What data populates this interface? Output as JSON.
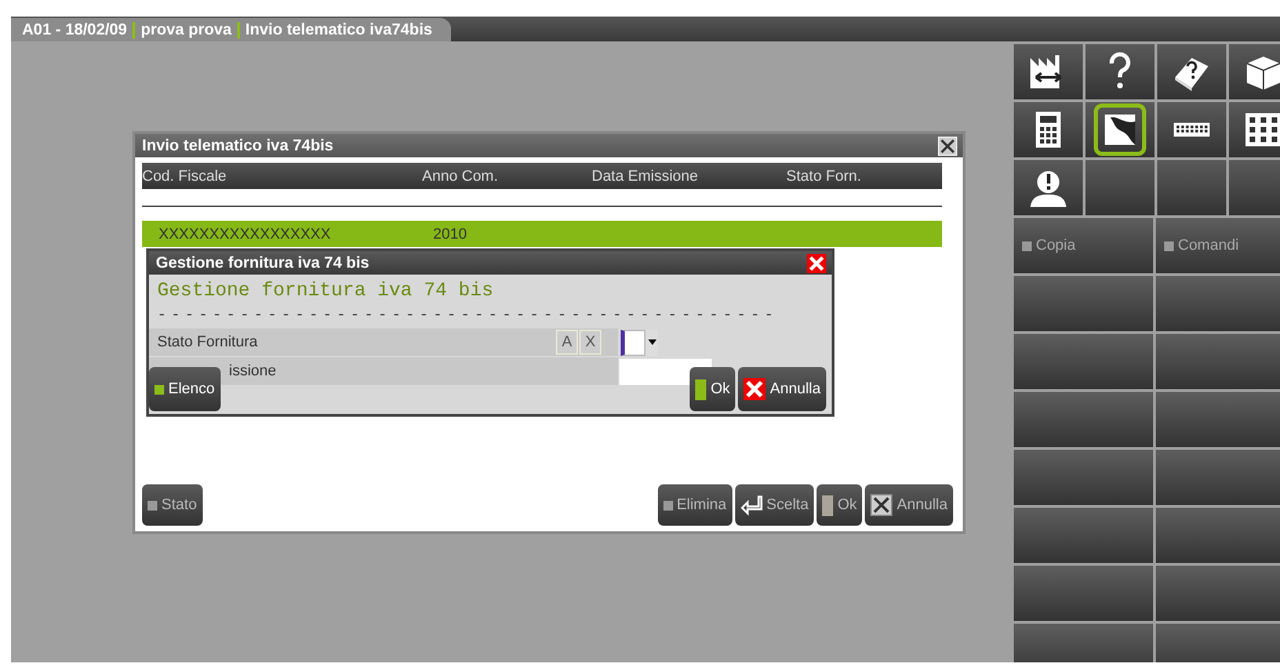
{
  "header_tab": {
    "segments": [
      "A01 - 18/02/09",
      "prova prova",
      "Invio telematico iva74bis"
    ]
  },
  "toolbar": {
    "icons": [
      {
        "kind": "factory",
        "selected": false
      },
      {
        "kind": "help",
        "selected": false
      },
      {
        "kind": "book-help",
        "selected": false
      },
      {
        "kind": "cube",
        "selected": false
      },
      {
        "kind": "calculator",
        "selected": false
      },
      {
        "kind": "hand",
        "selected": true
      },
      {
        "kind": "keyboard",
        "selected": false
      },
      {
        "kind": "grid",
        "selected": false
      },
      {
        "kind": "person-alert",
        "selected": false
      }
    ]
  },
  "side_buttons": [
    {
      "label": "Copia"
    },
    {
      "label": "Comandi"
    }
  ],
  "main_dialog": {
    "title": "Invio telematico iva 74bis",
    "columns": [
      "Cod. Fiscale",
      "Anno Com.",
      "Data Emissione",
      "Stato Forn."
    ],
    "rows": [
      {
        "cells": [
          "XXXXXXXXXXXXXXXXX",
          "2010"
        ],
        "selected": true
      }
    ],
    "buttons": [
      {
        "label": "Stato",
        "kind": "square"
      },
      {
        "label": "Elimina",
        "kind": "square"
      },
      {
        "label": "Scelta",
        "kind": "enter"
      },
      {
        "label": "Ok",
        "kind": "bar"
      },
      {
        "label": "Annulla",
        "kind": "cancel"
      }
    ]
  },
  "sub_dialog": {
    "title": "Gestione fornitura iva 74 bis",
    "heading": "Gestione fornitura iva 74 bis",
    "rule": "- - - - - - - - - - - - - - - - - - - - - - - - - - - - - - - - - - - - - - - - - - - - -",
    "fields": [
      {
        "label": "Stato Fornitura",
        "kind": "select",
        "letters": [
          "A",
          "X"
        ]
      },
      {
        "label": "issione",
        "kind": "text"
      }
    ],
    "buttons": [
      {
        "label": "Elenco",
        "kind": "green-square"
      },
      {
        "label": "Ok",
        "kind": "green-bar"
      },
      {
        "label": "Annulla",
        "kind": "red-x"
      }
    ]
  }
}
